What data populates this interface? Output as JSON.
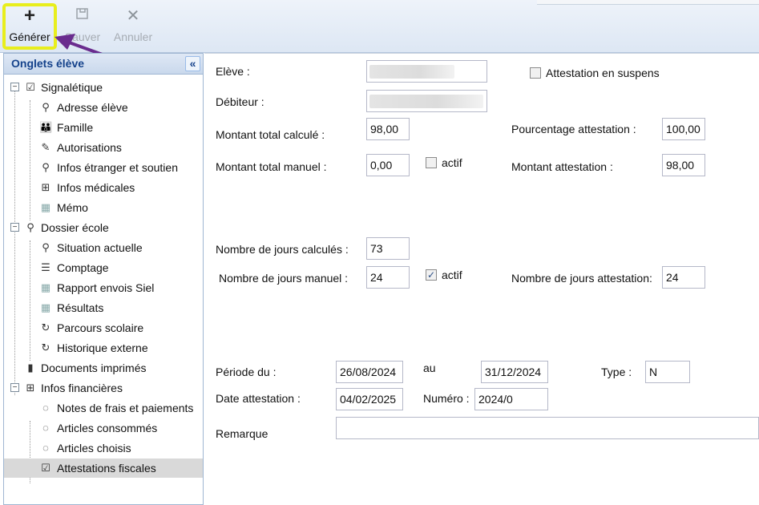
{
  "toolbar": {
    "generer": "Générer",
    "sauver": "Sauver",
    "annuler": "Annuler"
  },
  "sidebar": {
    "title": "Onglets élève",
    "nodes": [
      {
        "label": "Signalétique"
      },
      {
        "label": "Adresse élève"
      },
      {
        "label": "Famille"
      },
      {
        "label": "Autorisations"
      },
      {
        "label": "Infos étranger et soutien"
      },
      {
        "label": "Infos médicales"
      },
      {
        "label": "Mémo"
      },
      {
        "label": "Dossier école"
      },
      {
        "label": "Situation actuelle"
      },
      {
        "label": "Comptage"
      },
      {
        "label": "Rapport envois Siel"
      },
      {
        "label": "Résultats"
      },
      {
        "label": "Parcours scolaire"
      },
      {
        "label": "Historique externe"
      },
      {
        "label": "Documents imprimés"
      },
      {
        "label": "Infos financières"
      },
      {
        "label": "Notes de frais et paiements"
      },
      {
        "label": "Articles consommés"
      },
      {
        "label": "Articles choisis"
      },
      {
        "label": "Attestations fiscales"
      }
    ]
  },
  "form": {
    "eleve_label": "Elève :",
    "debiteur_label": "Débiteur :",
    "attestation_suspens_label": "Attestation en suspens",
    "montant_total_calcule_label": "Montant total calculé :",
    "montant_total_calcule": "98,00",
    "pourcentage_attestation_label": "Pourcentage attestation :",
    "pourcentage_attestation": "100,00",
    "montant_total_manuel_label": "Montant total manuel :",
    "montant_total_manuel": "0,00",
    "actif_label_1": "actif",
    "montant_attestation_label": "Montant attestation :",
    "montant_attestation": "98,00",
    "nb_jours_calcules_label": "Nombre de jours calculés :",
    "nb_jours_calcules": "73",
    "nb_jours_manuel_label": "Nombre de jours manuel :",
    "nb_jours_manuel": "24",
    "actif_label_2": "actif",
    "nb_jours_attestation_label": "Nombre de jours attestation:",
    "nb_jours_attestation": "24",
    "periode_du_label": "Période du :",
    "periode_du": "26/08/2024",
    "au_label": "au",
    "periode_au": "31/12/2024",
    "type_label": "Type :",
    "type": "N",
    "date_attestation_label": "Date attestation :",
    "date_attestation": "04/02/2025",
    "numero_label": "Numéro :",
    "numero": "2024/0",
    "remarque_label": "Remarque",
    "remarque": ""
  },
  "colors": {
    "highlight": "#e8ee1d",
    "arrow": "#6a2c8e",
    "sidebar_title": "#15428b"
  }
}
